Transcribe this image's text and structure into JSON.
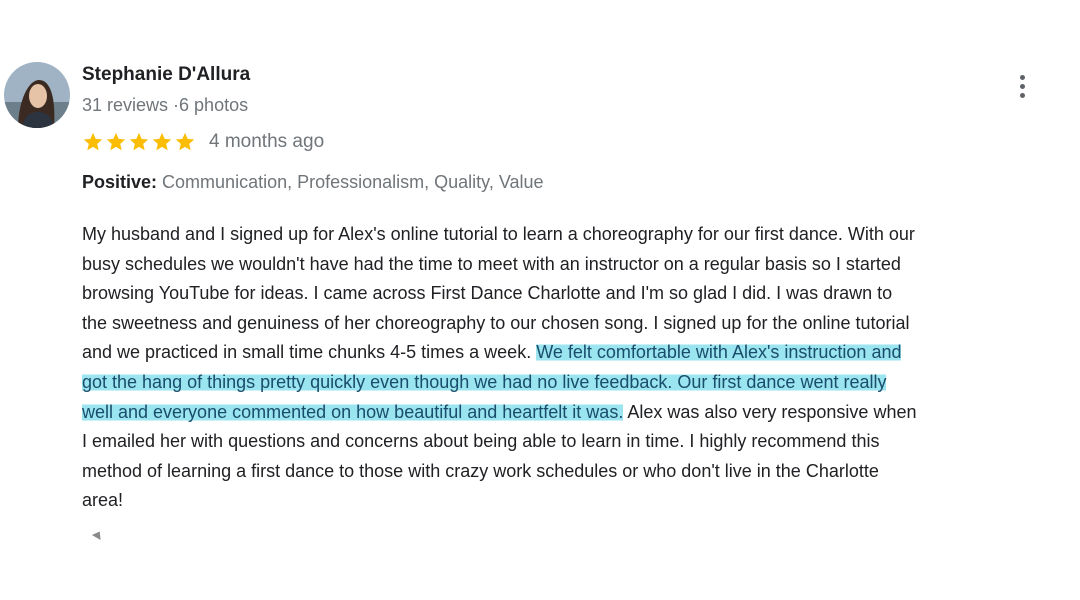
{
  "reviewer": {
    "name": "Stephanie D'Allura",
    "meta": "31 reviews ·6 photos"
  },
  "rating": {
    "stars": 5,
    "max_stars": 5,
    "star_color": "#fbbc04",
    "time": "4 months ago"
  },
  "attributes": {
    "label": "Positive:",
    "values": "Communication, Professionalism, Quality, Value"
  },
  "review": {
    "lines": [
      {
        "pre": "My husband and I signed up for Alex's online tutorial to learn a choreography for our first dance. With our",
        "hl": "",
        "post": ""
      },
      {
        "pre": "busy schedules we wouldn't have had the time to meet with an instructor on a regular basis so I started",
        "hl": "",
        "post": ""
      },
      {
        "pre": "browsing YouTube for ideas. I came across First Dance Charlotte and I'm so glad I did. I was drawn to",
        "hl": "",
        "post": ""
      },
      {
        "pre": "the sweetness and genuiness of her choreography to our chosen song. I signed up for the online tutorial",
        "hl": "",
        "post": ""
      },
      {
        "pre": "and we practiced in small time chunks 4-5 times a week. ",
        "hl": "We felt comfortable with Alex's instruction and",
        "post": ""
      },
      {
        "pre": "",
        "hl": "got the hang of things pretty quickly even though we had no live feedback. Our first dance went really",
        "post": ""
      },
      {
        "pre": "",
        "hl": "well and everyone commented on how beautiful and heartfelt it was.",
        "post": " Alex was also very responsive when"
      },
      {
        "pre": "I emailed her with questions and concerns about being able to learn in time. I highly recommend this",
        "hl": "",
        "post": ""
      },
      {
        "pre": "method of learning a first dance to those with crazy work schedules or who don't live in the Charlotte",
        "hl": "",
        "post": ""
      },
      {
        "pre": "area!",
        "hl": "",
        "post": ""
      }
    ],
    "highlight_color": "#78dceb"
  },
  "icons": {
    "menu": "more-vert-icon",
    "star": "star-icon",
    "collapse": "collapse-arrow-icon"
  }
}
